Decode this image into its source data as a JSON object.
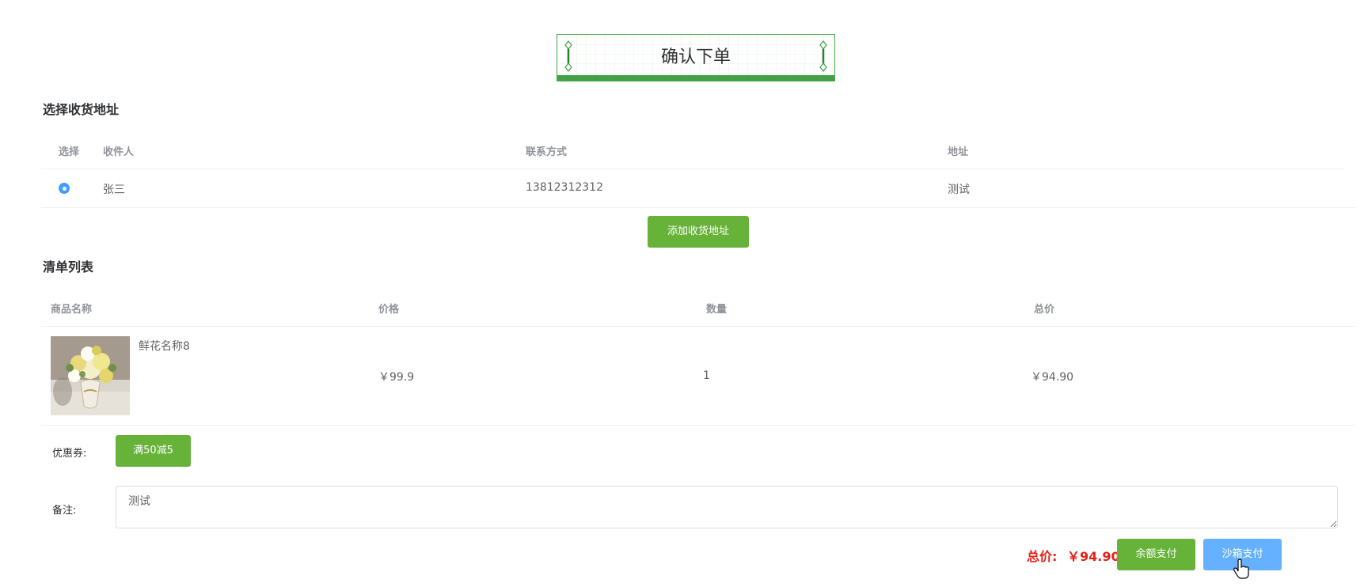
{
  "header": {
    "title": "确认下单"
  },
  "address": {
    "section_title": "选择收货地址",
    "columns": [
      "选择",
      "收件人",
      "联系方式",
      "地址"
    ],
    "rows": [
      {
        "selected": true,
        "receiver": "张三",
        "phone": "13812312312",
        "address": "测试"
      }
    ],
    "add_button": "添加收货地址"
  },
  "orders": {
    "section_title": "清单列表",
    "columns": [
      "商品名称",
      "价格",
      "数量",
      "总价"
    ],
    "rows": [
      {
        "name": "鲜花名称8",
        "price": "￥99.9",
        "quantity": "1",
        "total": "￥94.90",
        "image": "flower-vase-image"
      }
    ]
  },
  "coupon": {
    "label": "优惠券:",
    "button": "满50减5"
  },
  "remark": {
    "label": "备注:",
    "value": "测试"
  },
  "footer": {
    "total_label": "总价:",
    "total_value": "￥94.90",
    "balance_pay": "余额支付",
    "sandbox_pay": "沙箱支付"
  },
  "colors": {
    "accent_green": "#67b239",
    "banner_green": "#43a047",
    "sandbox_blue": "#66b1ff",
    "price_red": "#e62117",
    "radio_blue": "#409eff"
  }
}
